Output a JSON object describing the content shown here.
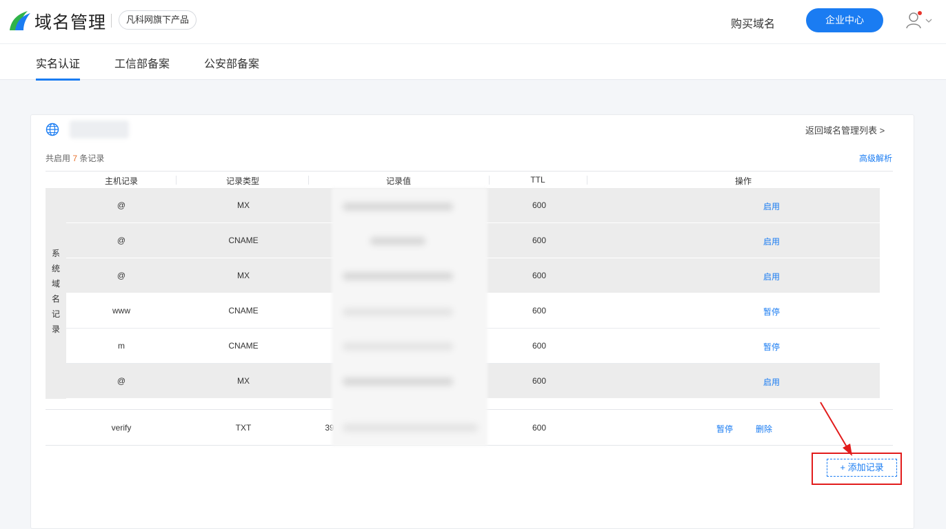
{
  "header": {
    "brand": "域名管理",
    "badge": "凡科网旗下产品",
    "buy_link": "购买域名",
    "enterprise_button": "企业中心",
    "accent": "#1a7cf2"
  },
  "subnav": {
    "tabs": [
      {
        "label": "实名认证",
        "active": true
      },
      {
        "label": "工信部备案",
        "active": false
      },
      {
        "label": "公安部备案",
        "active": false
      }
    ]
  },
  "card": {
    "back_link": "返回域名管理列表 >",
    "count_prefix": "共启用 ",
    "count_value": "7",
    "count_suffix": " 条记录",
    "advanced_link": "高级解析",
    "columns": [
      "主机记录",
      "记录类型",
      "记录值",
      "TTL",
      "操作"
    ],
    "system_label": "系统域名记录",
    "system_rows": [
      {
        "host": "@",
        "type": "MX",
        "ttl": "600",
        "op": "启用"
      },
      {
        "host": "@",
        "type": "CNAME",
        "ttl": "600",
        "op": "启用"
      },
      {
        "host": "@",
        "type": "MX",
        "ttl": "600",
        "op": "启用"
      },
      {
        "host": "www",
        "type": "CNAME",
        "ttl": "600",
        "op": "暂停"
      },
      {
        "host": "m",
        "type": "CNAME",
        "ttl": "600",
        "op": "暂停"
      },
      {
        "host": "@",
        "type": "MX",
        "ttl": "600",
        "op": "启用"
      }
    ],
    "custom_row": {
      "host": "verify",
      "type": "TXT",
      "value_prefix": "39",
      "ttl": "600",
      "op_pause": "暂停",
      "op_delete": "删除"
    },
    "add_button": "+ 添加记录"
  }
}
